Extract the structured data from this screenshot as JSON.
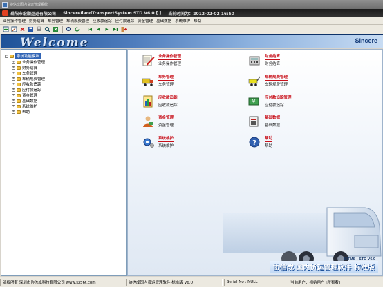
{
  "window": {
    "title": "协信成国内货运管理系统"
  },
  "infobar": {
    "company": "岳阳市宏顺运运有限公司",
    "system": "SincereIlandTransportSystem STD V6.0 [ ]",
    "time": "当前时间为：2012-02-02 16:50"
  },
  "menu": [
    "业务操作管理",
    "财务结算",
    "车务管理",
    "车辆规费管理",
    "应收款追踪",
    "应付款追踪",
    "资金管理",
    "基础数据",
    "系统维护",
    "帮助"
  ],
  "toolbar_icons": [
    "add-icon",
    "edit-icon",
    "delete-icon",
    "save-icon",
    "print-icon",
    "preview-icon",
    "export-icon",
    "find-icon",
    "refresh-icon",
    "first-icon",
    "prev-icon",
    "next-icon",
    "last-icon",
    "exit-icon"
  ],
  "banner": {
    "welcome": "Welcome",
    "brand": "Sincere"
  },
  "tree": {
    "root": "系统功能模块",
    "items": [
      "业务操作管理",
      "财务结算",
      "车务管理",
      "车辆规费管理",
      "应收款追踪",
      "应付款追踪",
      "资金管理",
      "基础数据",
      "系统维护",
      "帮助"
    ]
  },
  "modules": [
    {
      "title": "业务操作管理",
      "sub": "业务操作管理"
    },
    {
      "title": "财务结算",
      "sub": "财务结算"
    },
    {
      "title": "车务管理",
      "sub": "车务管理"
    },
    {
      "title": "车辆规费管理",
      "sub": "车辆规费管理"
    },
    {
      "title": "应收款追踪",
      "sub": "应收款追踪"
    },
    {
      "title": "应付款追踪管理",
      "sub": "应付款追踪"
    },
    {
      "title": "资金管理",
      "sub": "资金管理"
    },
    {
      "title": "基础数据",
      "sub": "基础数据"
    },
    {
      "title": "系统维护",
      "sub": "系统维护"
    },
    {
      "title": "帮助",
      "sub": "帮助"
    }
  ],
  "branding": {
    "product": "协信成 国内货运管理软件 标准版",
    "version": "SITMS - STD V6.0"
  },
  "status": {
    "copyright": "版权所有 深圳市协信成科技有限公司 www.sz56t.com",
    "product": "协信成国内货运管理软件 标准版 V6.0",
    "serial": "Serial No : NULL",
    "user": "当前用户：初始用户 [所有者]"
  },
  "colors": {
    "accent": "#c8101a",
    "banner": "#1e5298",
    "selection": "#3164b5"
  }
}
